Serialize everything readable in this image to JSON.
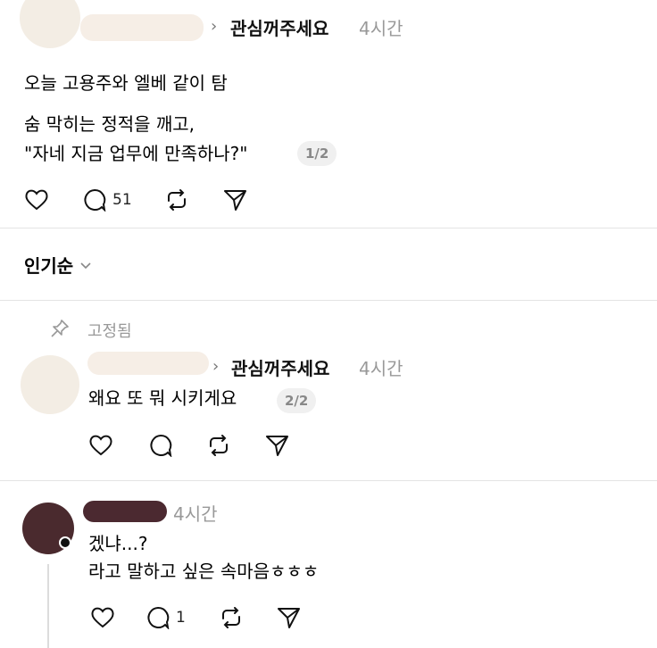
{
  "post": {
    "topic": "관심꺼주세요",
    "time": "4시간",
    "line1": "오늘 고용주와 엘베 같이 탐",
    "line2": "숨 막히는 정적을 깨고,",
    "line3": "\"자네 지금 업무에 만족하나?\"",
    "pager": "1/2",
    "replies_count": "51"
  },
  "sort": {
    "label": "인기순"
  },
  "pinned": {
    "label": "고정됨",
    "topic": "관심꺼주세요",
    "time": "4시간",
    "text": "왜요 또 뭐 시키게요",
    "pager": "2/2"
  },
  "comment": {
    "time": "4시간",
    "line1": "겠냐...?",
    "line2": "라고 말하고 싶은 속마음ㅎㅎㅎ",
    "replies_count": "1"
  },
  "colors": {
    "avatar_blur": "#f3ede4",
    "name_blur": "#f6eee6",
    "dark_avatar": "#4a2a2e",
    "dark_name": "#4b2930",
    "divider": "#e4e4e4",
    "muted": "#999999"
  },
  "icons": [
    "heart-icon",
    "comment-icon",
    "repost-icon",
    "share-icon",
    "chevron-down-icon",
    "pin-icon",
    "chevron-right-icon"
  ]
}
